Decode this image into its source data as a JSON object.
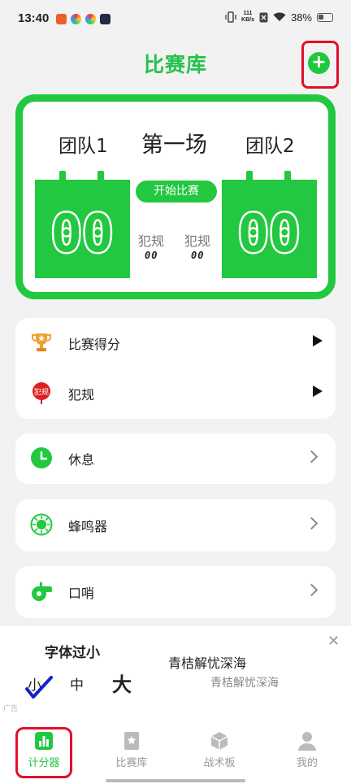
{
  "status_bar": {
    "time": "13:40",
    "net_speed": "111",
    "net_unit": "KB/s",
    "battery": "38%"
  },
  "header": {
    "title": "比赛库",
    "add_icon": "plus-icon"
  },
  "scoreboard": {
    "team1": "团队1",
    "team2": "团队2",
    "match": "第一场",
    "start_button": "开始比赛",
    "score1": "00",
    "score2": "00",
    "foul_label_1": "犯规",
    "foul_label_2": "犯规",
    "foul1": "00",
    "foul2": "00"
  },
  "menu": {
    "group1": [
      {
        "label": "比赛得分",
        "icon": "trophy-icon"
      },
      {
        "label": "犯规",
        "icon": "foul-sign-icon"
      }
    ],
    "rest": {
      "label": "休息",
      "icon": "clock-icon"
    },
    "buzzer": {
      "label": "蜂鸣器",
      "icon": "buzzer-icon"
    },
    "whistle": {
      "label": "口哨",
      "icon": "whistle-icon"
    }
  },
  "ad": {
    "title": "字体过小",
    "subtitle": "青桔解忧深海",
    "subtitle2": "青桔解忧深海",
    "size_small": "小",
    "size_medium": "中",
    "size_large": "大",
    "tag": "广告"
  },
  "tabs": [
    {
      "label": "计分器",
      "icon": "bar-chart-icon",
      "active": true
    },
    {
      "label": "比赛库",
      "icon": "star-book-icon",
      "active": false
    },
    {
      "label": "战术板",
      "icon": "cube-icon",
      "active": false
    },
    {
      "label": "我的",
      "icon": "person-icon",
      "active": false
    }
  ],
  "colors": {
    "accent": "#22c840",
    "highlight_box": "#e0102a"
  }
}
